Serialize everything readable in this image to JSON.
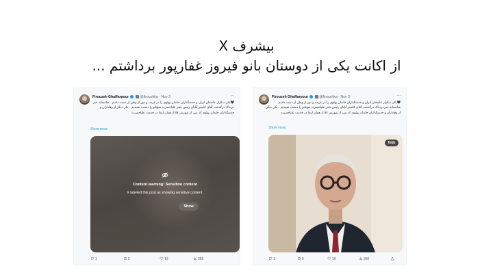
{
  "slide": {
    "title": "بیشرف X",
    "subtitle": "از اکانت یکی از دوستان بانو فیروز غفارپور برداشتم ..."
  },
  "tweets": [
    {
      "author_name": "Firouzeh Ghaffarpour",
      "handle": "@firouchka",
      "separator": "·",
      "date": "Nov 3",
      "text": "🖤یکی دیگراز عاشقان ایران و خدمتگذاران خاندان پهلوی را در غربت و دور از وطن از دست دادیم . متاسفانه خبر دردناک درگذشت آقای کامبیز آتابای رئیس دفتر علیاحضرت شهبانو را دیشب شنیدیم . یکی دیگر از وفاداران و خدمتگذاران خاندان پهلوی که پس از شورش ۵۷ از همان ابتدا در خدمت علیاحضرت",
      "show_more": "Show more",
      "warning_title": "Content warning: Sensitive content",
      "warning_body": "X labeled this post as showing sensitive content.",
      "show_button": "Show",
      "replies": "1",
      "reposts": "5",
      "likes": "19",
      "views": "366",
      "icons": [
        "more-icon",
        "verified-icon",
        "eye-off-icon",
        "reply-icon",
        "repost-icon",
        "like-icon",
        "views-icon"
      ]
    },
    {
      "author_name": "Firouzeh Ghaffarpour",
      "handle": "@firouchka",
      "separator": "·",
      "date": "Nov 3",
      "text": "🖤یکی دیگراز عاشقان ایران و خدمتگذاران خاندان پهلوی را در غربت و دور از وطن از دست دادیم . متاسفانه خبر دردناک درگذشت آقای کامبیز آتابای رئیس دفتر علیاحضرت شهبانو را دیشب شنیدیم . یکی دیگر از وفاداران و خدمتگذاران خاندان پهلوی که پس از شورش ۵۷ از همان ابتدا در خدمت علیاحضرت",
      "show_more": "Show more",
      "hide_button": "Hide",
      "replies": "1",
      "reposts": "5",
      "likes": "19",
      "views": "366",
      "icons": [
        "more-icon",
        "verified-icon",
        "reply-icon",
        "repost-icon",
        "like-icon",
        "views-icon",
        "share-icon"
      ]
    }
  ],
  "colors": {
    "link": "#1d9bf0",
    "muted": "#536471",
    "card_bg": "#f7f8f9",
    "blur_bg": "#55504b"
  }
}
